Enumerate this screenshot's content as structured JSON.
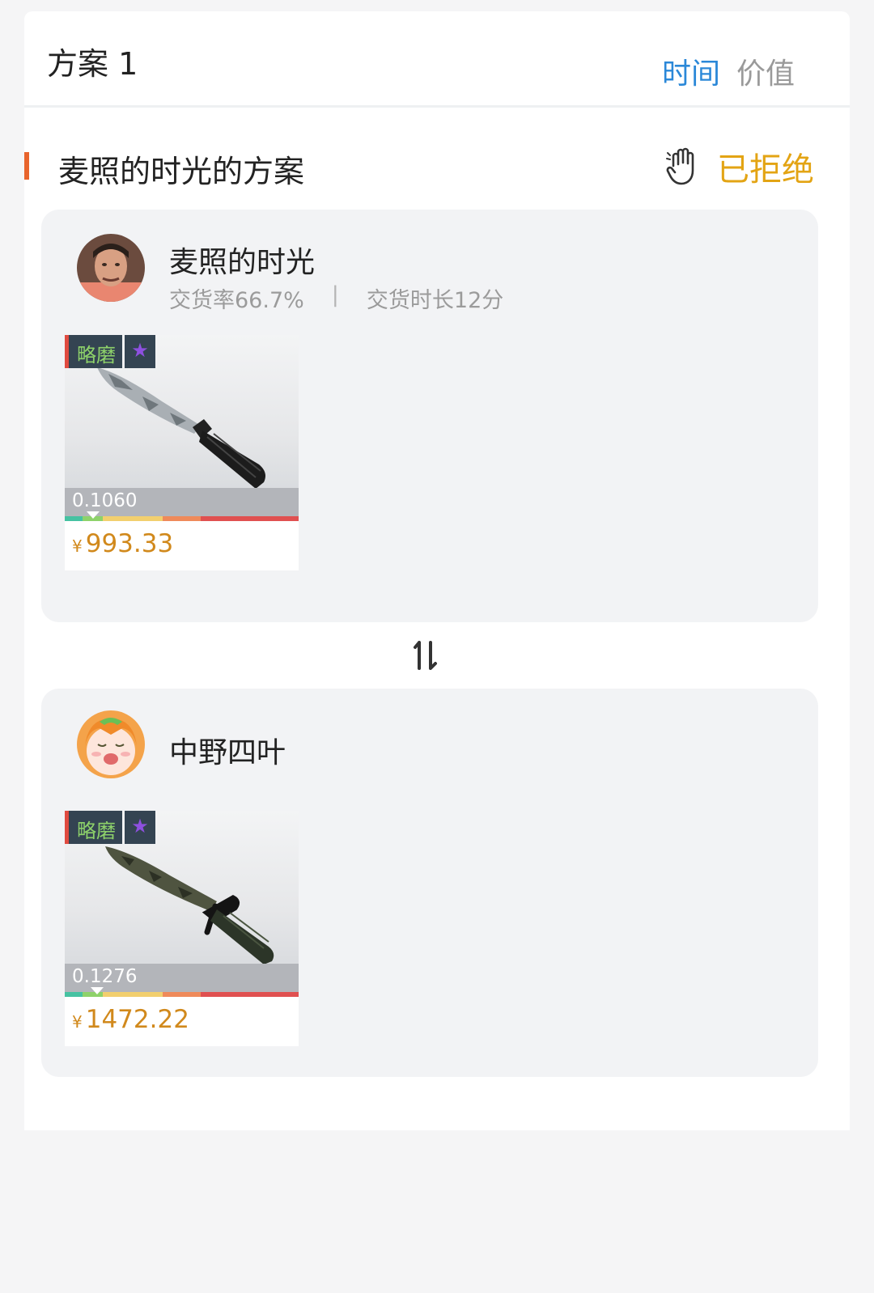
{
  "header": {
    "title": "方案 1",
    "sort_time": "时间",
    "sort_value": "价值",
    "active_sort": "时间"
  },
  "proposal": {
    "title": "麦照的时光的方案",
    "status": "已拒绝",
    "status_icon": "raised-hand-icon",
    "status_color": "#e3a414",
    "accent_color": "#e8642c"
  },
  "party_a": {
    "name": "麦照的时光",
    "delivery_rate": "交货率66.7%",
    "separator": "|",
    "delivery_time": "交货时长12分",
    "item": {
      "wear_label": "略磨",
      "star": "★",
      "float": "0.1060",
      "float_value": 0.106,
      "currency": "¥",
      "price": "993.33",
      "image": "knife-icon"
    }
  },
  "swap_icon": "swap-arrows-icon",
  "party_b": {
    "name": "中野四叶",
    "item": {
      "wear_label": "略磨",
      "star": "★",
      "float": "0.1276",
      "float_value": 0.1276,
      "currency": "¥",
      "price": "1472.22",
      "image": "bayonet-icon"
    }
  }
}
